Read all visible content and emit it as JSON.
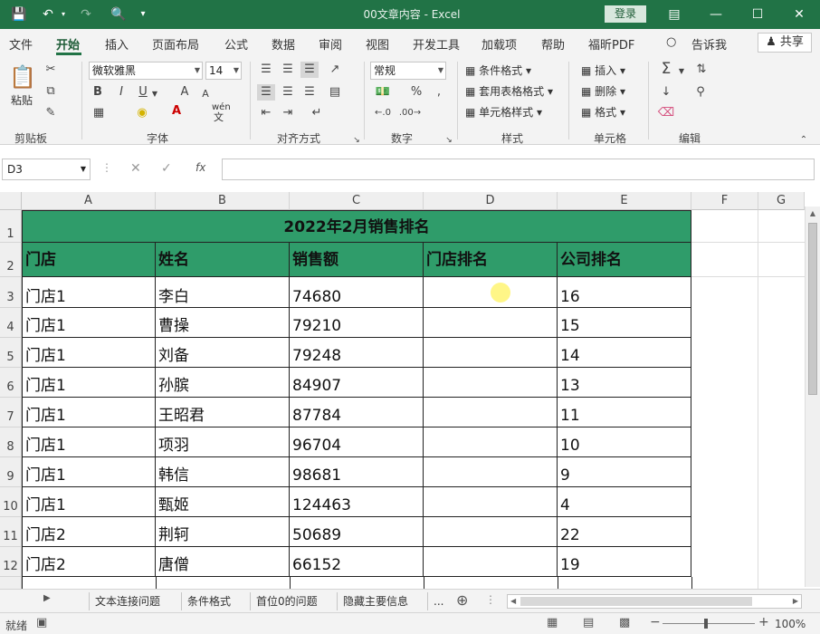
{
  "title": {
    "doc": "00文章内容",
    "app": "Excel",
    "sep": " - ",
    "login": "登录"
  },
  "menu": {
    "items": [
      "文件",
      "开始",
      "插入",
      "页面布局",
      "公式",
      "数据",
      "审阅",
      "视图",
      "开发工具",
      "加载项",
      "帮助",
      "福昕PDF"
    ],
    "tell_me": "告诉我",
    "share": "共享"
  },
  "ribbon": {
    "clipboard": {
      "paste": "粘贴",
      "label": "剪贴板"
    },
    "font": {
      "family": "微软雅黑",
      "size": "14",
      "bold": "B",
      "italic": "I",
      "underline": "U",
      "grow": "A",
      "shrink": "A",
      "wen": "wén",
      "wen_char": "文",
      "label": "字体"
    },
    "align": {
      "label": "对齐方式"
    },
    "number": {
      "format": "常规",
      "percent": "%",
      "label": "数字"
    },
    "styles": {
      "cond": "条件格式",
      "table": "套用表格格式",
      "cell": "单元格样式",
      "label": "样式"
    },
    "cells": {
      "insert": "插入",
      "delete": "删除",
      "format": "格式",
      "label": "单元格"
    },
    "editing": {
      "label": "编辑"
    }
  },
  "formula_bar": {
    "name_box": "D3",
    "fx": "fx",
    "value": ""
  },
  "sheet": {
    "columns": [
      "A",
      "B",
      "C",
      "D",
      "E",
      "F",
      "G"
    ],
    "row_numbers": [
      "1",
      "2",
      "3",
      "4",
      "5",
      "6",
      "7",
      "8",
      "9",
      "10",
      "11",
      "12"
    ],
    "title": "2022年2月销售排名",
    "headers": [
      "门店",
      "姓名",
      "销售额",
      "门店排名",
      "公司排名"
    ],
    "rows": [
      [
        "门店1",
        "李白",
        "74680",
        "",
        "16"
      ],
      [
        "门店1",
        "曹操",
        "79210",
        "",
        "15"
      ],
      [
        "门店1",
        "刘备",
        "79248",
        "",
        "14"
      ],
      [
        "门店1",
        "孙膑",
        "84907",
        "",
        "13"
      ],
      [
        "门店1",
        "王昭君",
        "87784",
        "",
        "11"
      ],
      [
        "门店1",
        "项羽",
        "96704",
        "",
        "10"
      ],
      [
        "门店1",
        "韩信",
        "98681",
        "",
        "9"
      ],
      [
        "门店1",
        "甄姬",
        "124463",
        "",
        "4"
      ],
      [
        "门店2",
        "荆轲",
        "50689",
        "",
        "22"
      ],
      [
        "门店2",
        "唐僧",
        "66152",
        "",
        "19"
      ]
    ]
  },
  "tabs": {
    "items": [
      "文本连接问题",
      "条件格式",
      "首位0的问题",
      "隐藏主要信息"
    ],
    "more": "..."
  },
  "status": {
    "ready": "就绪",
    "zoom": "100%"
  },
  "colors": {
    "titlebar": "#217346",
    "header_fill": "#2f9c6a",
    "accent": "#1e5c37"
  }
}
